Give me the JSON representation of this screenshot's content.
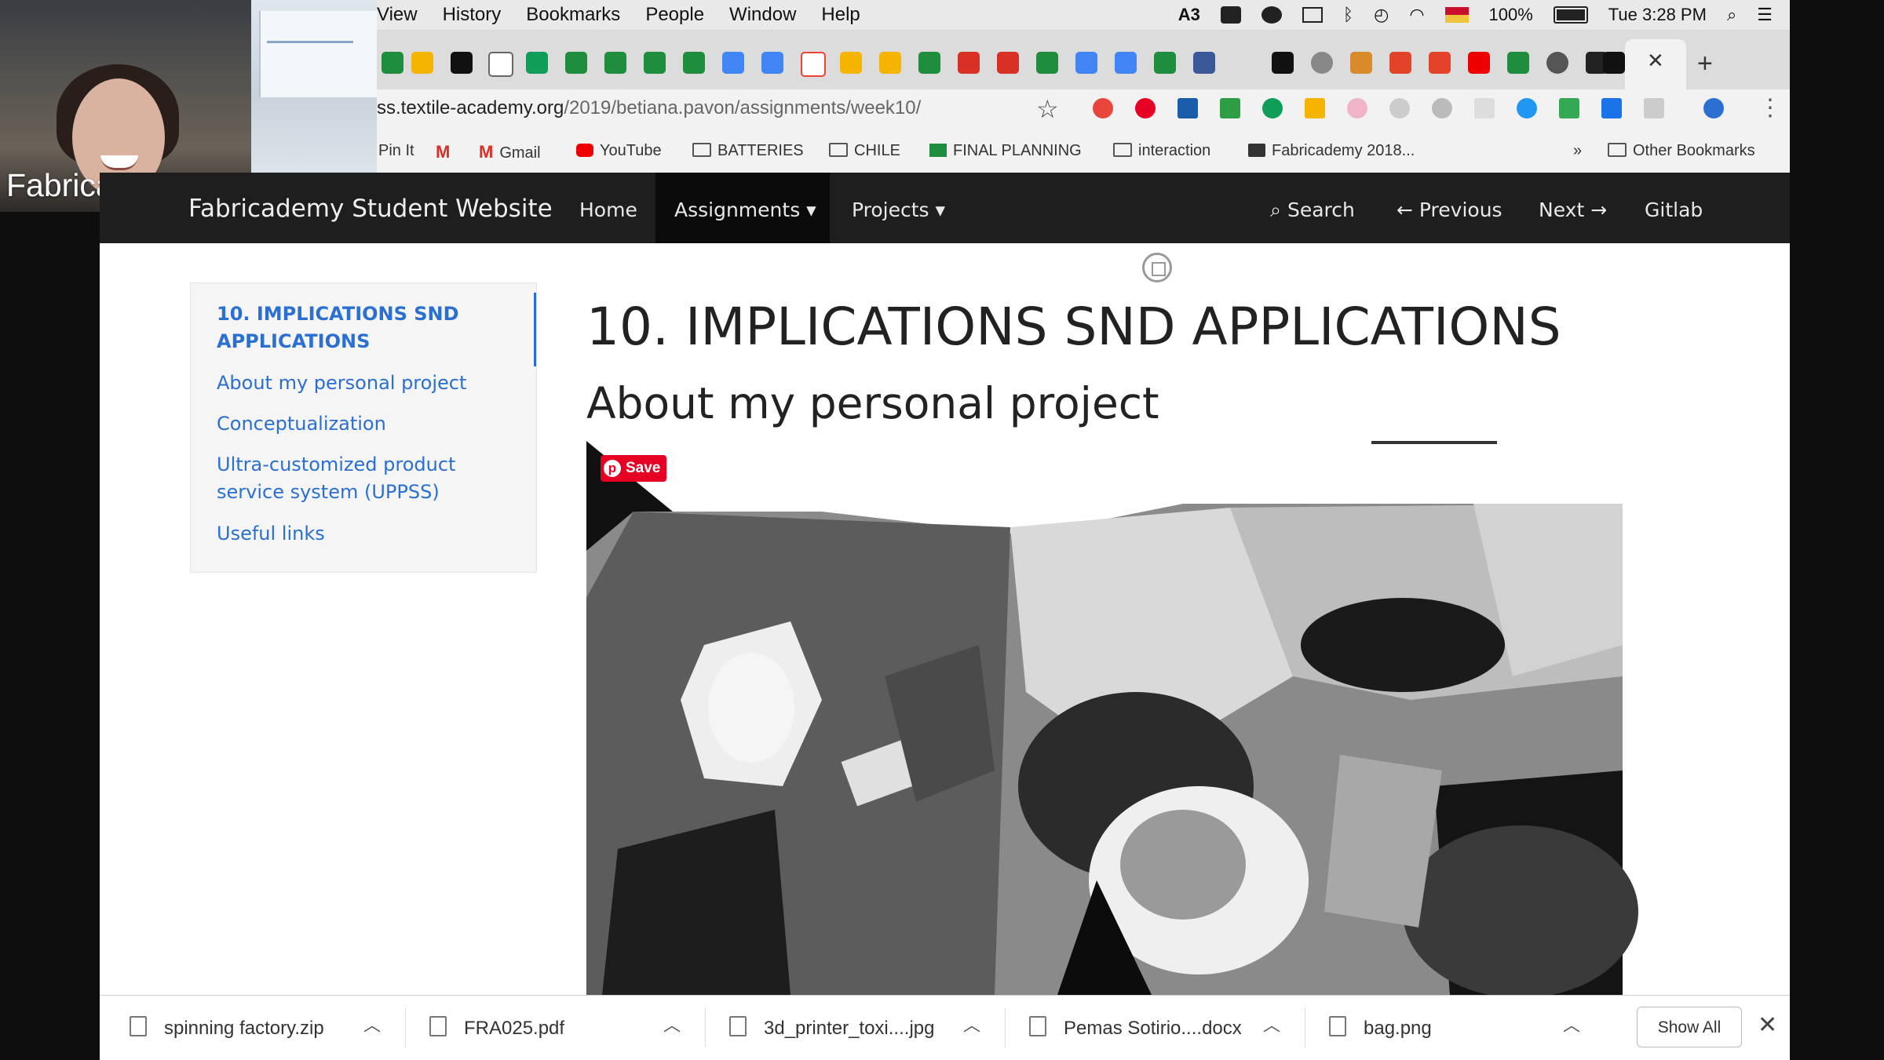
{
  "call": {
    "participant_label": "Fabricademy"
  },
  "menubar": {
    "items": [
      "View",
      "History",
      "Bookmarks",
      "People",
      "Window",
      "Help"
    ],
    "status_number": "3",
    "battery_text": "100%",
    "clock": "Tue 3:28 PM"
  },
  "browser": {
    "url_host": "ss.textile-academy.org",
    "url_path": "/2019/betiana.pavon/assignments/week10/",
    "bookmarks": [
      "Pin It",
      "Gmail",
      "YouTube",
      "BATTERIES",
      "CHILE",
      "FINAL PLANNING",
      "interaction",
      "Fabricademy 2018...",
      "»",
      "Other Bookmarks"
    ]
  },
  "site": {
    "brand": "Fabricademy Student Website",
    "nav": {
      "home": "Home",
      "assignments": "Assignments ▾",
      "projects": "Projects ▾",
      "search": "Search",
      "previous": "Previous",
      "next": "Next",
      "gitlab": "Gitlab"
    },
    "toc": {
      "active": "10. IMPLICATIONS SND APPLICATIONS",
      "items": [
        "About my personal project",
        "Conceptualization",
        "Ultra-customized product service system (UPPSS)",
        "Useful links"
      ]
    },
    "title": "10. IMPLICATIONS SND APPLICATIONS",
    "subtitle": "About my personal project",
    "pin_save": "Save"
  },
  "downloads": {
    "files": [
      "spinning factory.zip",
      "FRA025.pdf",
      "3d_printer_toxi....jpg",
      "Pemas Sotirio....docx",
      "bag.png"
    ],
    "show_all": "Show All"
  },
  "colors": {
    "link": "#2a6fd1",
    "navbar": "#1e1e1e",
    "pinterest": "#e60023"
  }
}
